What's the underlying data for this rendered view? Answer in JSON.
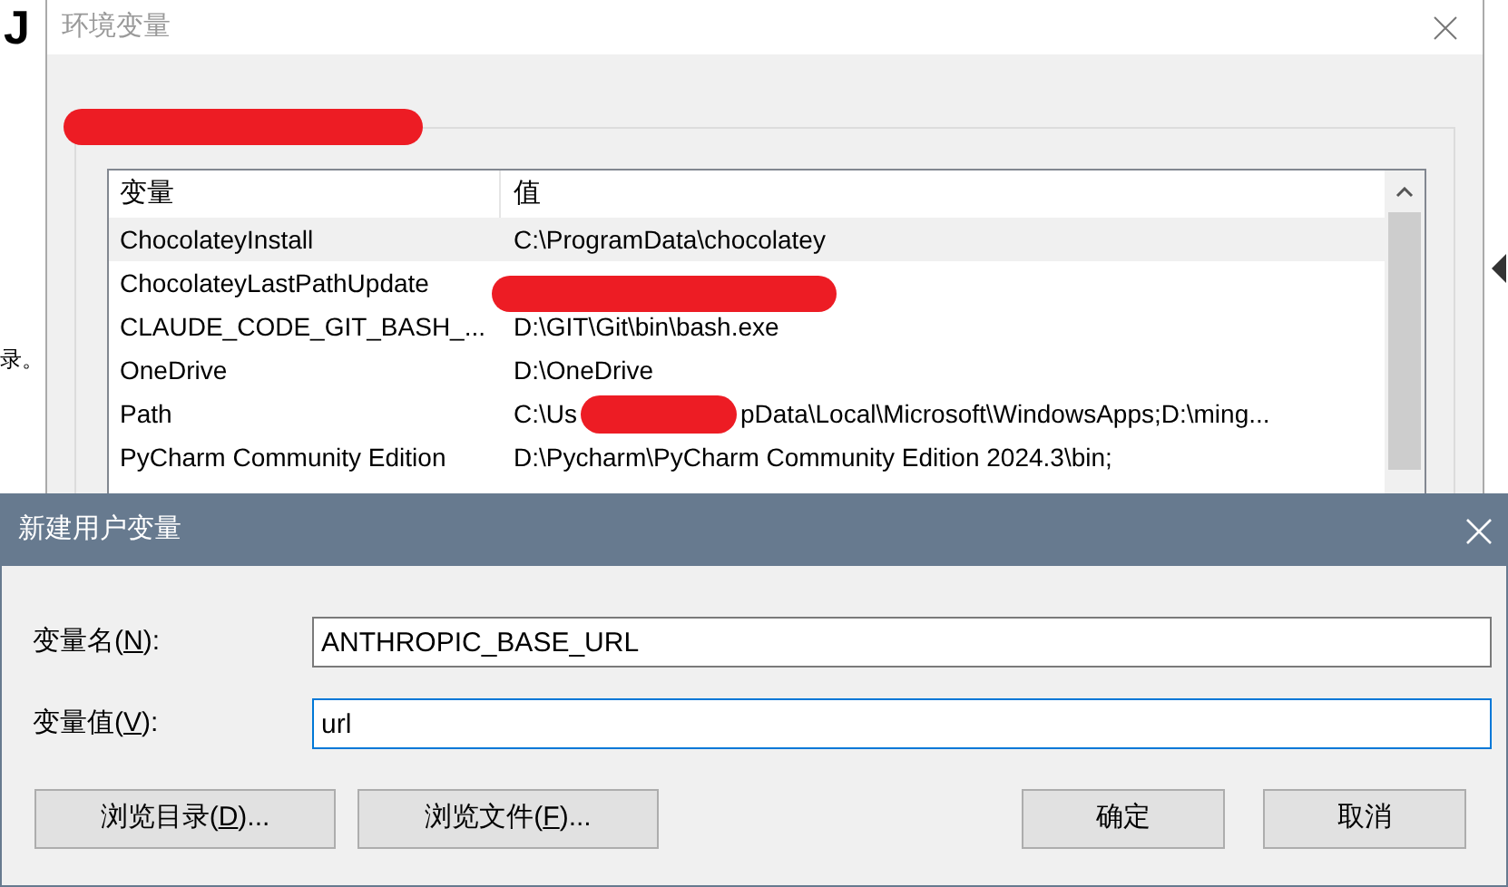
{
  "background_window": {
    "texts": [
      "J",
      "录。"
    ]
  },
  "env_window": {
    "title": "环境变量",
    "columns": [
      "变量",
      "值"
    ],
    "rows": [
      {
        "name": "ChocolateyInstall",
        "value": [
          "C:\\ProgramData\\chocolatey"
        ],
        "selected": true
      },
      {
        "name": "ChocolateyLastPathUpdate",
        "value": [],
        "selected": false
      },
      {
        "name": "CLAUDE_CODE_GIT_BASH_...",
        "value": [
          "D:\\GIT\\Git\\bin\\bash.exe"
        ],
        "selected": false
      },
      {
        "name": "OneDrive",
        "value": [
          "D:\\OneDrive"
        ],
        "selected": false
      },
      {
        "name": "Path",
        "value": [
          "C:\\Us",
          "pData\\Local\\Microsoft\\WindowsApps;D:\\ming..."
        ],
        "selected": false
      },
      {
        "name": "PyCharm Community Edition",
        "value": [
          "D:\\Pycharm\\PyCharm Community Edition 2024.3\\bin;"
        ],
        "selected": false
      }
    ]
  },
  "dialog": {
    "title": "新建用户变量",
    "fields": [
      {
        "label": {
          "before": "变量名(",
          "key": "N",
          "after": "):"
        },
        "value": "ANTHROPIC_BASE_URL",
        "focused": false
      },
      {
        "label": {
          "before": "变量值(",
          "key": "V",
          "after": "):"
        },
        "value": "url",
        "focused": true
      }
    ],
    "buttons": [
      {
        "before": "浏览目录(",
        "key": "D",
        "after": ")..."
      },
      {
        "before": "浏览文件(",
        "key": "F",
        "after": ")..."
      },
      {
        "before": "确定"
      },
      {
        "before": "取消"
      }
    ]
  }
}
